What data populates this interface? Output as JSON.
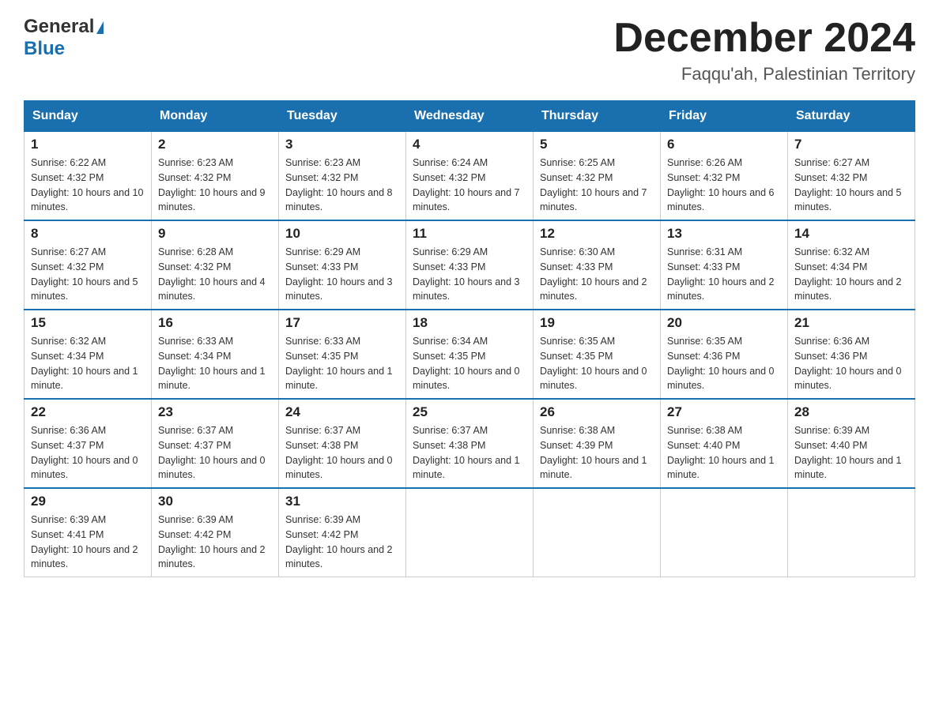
{
  "header": {
    "logo_general": "General",
    "logo_blue": "Blue",
    "month_title": "December 2024",
    "location": "Faqqu'ah, Palestinian Territory"
  },
  "calendar": {
    "days_of_week": [
      "Sunday",
      "Monday",
      "Tuesday",
      "Wednesday",
      "Thursday",
      "Friday",
      "Saturday"
    ],
    "weeks": [
      [
        {
          "day": "1",
          "sunrise": "6:22 AM",
          "sunset": "4:32 PM",
          "daylight": "10 hours and 10 minutes."
        },
        {
          "day": "2",
          "sunrise": "6:23 AM",
          "sunset": "4:32 PM",
          "daylight": "10 hours and 9 minutes."
        },
        {
          "day": "3",
          "sunrise": "6:23 AM",
          "sunset": "4:32 PM",
          "daylight": "10 hours and 8 minutes."
        },
        {
          "day": "4",
          "sunrise": "6:24 AM",
          "sunset": "4:32 PM",
          "daylight": "10 hours and 7 minutes."
        },
        {
          "day": "5",
          "sunrise": "6:25 AM",
          "sunset": "4:32 PM",
          "daylight": "10 hours and 7 minutes."
        },
        {
          "day": "6",
          "sunrise": "6:26 AM",
          "sunset": "4:32 PM",
          "daylight": "10 hours and 6 minutes."
        },
        {
          "day": "7",
          "sunrise": "6:27 AM",
          "sunset": "4:32 PM",
          "daylight": "10 hours and 5 minutes."
        }
      ],
      [
        {
          "day": "8",
          "sunrise": "6:27 AM",
          "sunset": "4:32 PM",
          "daylight": "10 hours and 5 minutes."
        },
        {
          "day": "9",
          "sunrise": "6:28 AM",
          "sunset": "4:32 PM",
          "daylight": "10 hours and 4 minutes."
        },
        {
          "day": "10",
          "sunrise": "6:29 AM",
          "sunset": "4:33 PM",
          "daylight": "10 hours and 3 minutes."
        },
        {
          "day": "11",
          "sunrise": "6:29 AM",
          "sunset": "4:33 PM",
          "daylight": "10 hours and 3 minutes."
        },
        {
          "day": "12",
          "sunrise": "6:30 AM",
          "sunset": "4:33 PM",
          "daylight": "10 hours and 2 minutes."
        },
        {
          "day": "13",
          "sunrise": "6:31 AM",
          "sunset": "4:33 PM",
          "daylight": "10 hours and 2 minutes."
        },
        {
          "day": "14",
          "sunrise": "6:32 AM",
          "sunset": "4:34 PM",
          "daylight": "10 hours and 2 minutes."
        }
      ],
      [
        {
          "day": "15",
          "sunrise": "6:32 AM",
          "sunset": "4:34 PM",
          "daylight": "10 hours and 1 minute."
        },
        {
          "day": "16",
          "sunrise": "6:33 AM",
          "sunset": "4:34 PM",
          "daylight": "10 hours and 1 minute."
        },
        {
          "day": "17",
          "sunrise": "6:33 AM",
          "sunset": "4:35 PM",
          "daylight": "10 hours and 1 minute."
        },
        {
          "day": "18",
          "sunrise": "6:34 AM",
          "sunset": "4:35 PM",
          "daylight": "10 hours and 0 minutes."
        },
        {
          "day": "19",
          "sunrise": "6:35 AM",
          "sunset": "4:35 PM",
          "daylight": "10 hours and 0 minutes."
        },
        {
          "day": "20",
          "sunrise": "6:35 AM",
          "sunset": "4:36 PM",
          "daylight": "10 hours and 0 minutes."
        },
        {
          "day": "21",
          "sunrise": "6:36 AM",
          "sunset": "4:36 PM",
          "daylight": "10 hours and 0 minutes."
        }
      ],
      [
        {
          "day": "22",
          "sunrise": "6:36 AM",
          "sunset": "4:37 PM",
          "daylight": "10 hours and 0 minutes."
        },
        {
          "day": "23",
          "sunrise": "6:37 AM",
          "sunset": "4:37 PM",
          "daylight": "10 hours and 0 minutes."
        },
        {
          "day": "24",
          "sunrise": "6:37 AM",
          "sunset": "4:38 PM",
          "daylight": "10 hours and 0 minutes."
        },
        {
          "day": "25",
          "sunrise": "6:37 AM",
          "sunset": "4:38 PM",
          "daylight": "10 hours and 1 minute."
        },
        {
          "day": "26",
          "sunrise": "6:38 AM",
          "sunset": "4:39 PM",
          "daylight": "10 hours and 1 minute."
        },
        {
          "day": "27",
          "sunrise": "6:38 AM",
          "sunset": "4:40 PM",
          "daylight": "10 hours and 1 minute."
        },
        {
          "day": "28",
          "sunrise": "6:39 AM",
          "sunset": "4:40 PM",
          "daylight": "10 hours and 1 minute."
        }
      ],
      [
        {
          "day": "29",
          "sunrise": "6:39 AM",
          "sunset": "4:41 PM",
          "daylight": "10 hours and 2 minutes."
        },
        {
          "day": "30",
          "sunrise": "6:39 AM",
          "sunset": "4:42 PM",
          "daylight": "10 hours and 2 minutes."
        },
        {
          "day": "31",
          "sunrise": "6:39 AM",
          "sunset": "4:42 PM",
          "daylight": "10 hours and 2 minutes."
        },
        null,
        null,
        null,
        null
      ]
    ]
  }
}
